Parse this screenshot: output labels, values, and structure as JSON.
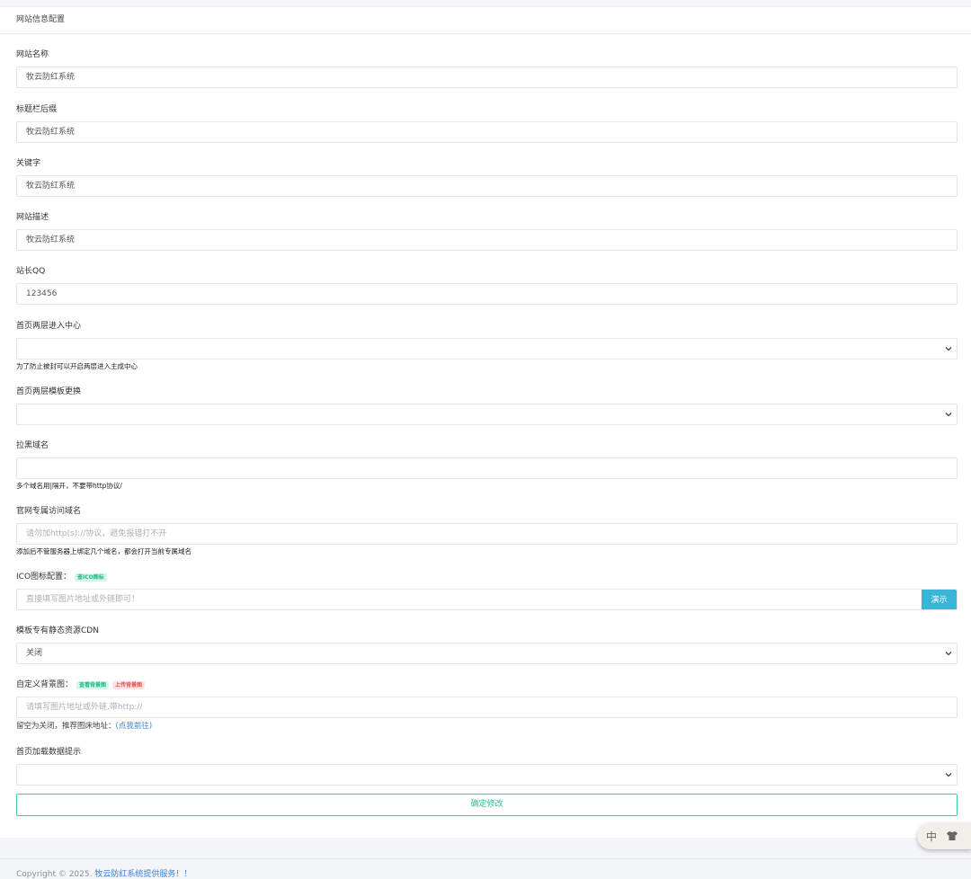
{
  "header": {
    "title": "网站信息配置"
  },
  "fields": {
    "site_name": {
      "label": "网站名称",
      "value": "牧云防红系统"
    },
    "title_suffix": {
      "label": "标题栏后缀",
      "value": "牧云防红系统"
    },
    "keywords": {
      "label": "关键字",
      "value": "牧云防红系统"
    },
    "description": {
      "label": "网站描述",
      "value": "牧云防红系统"
    },
    "qq": {
      "label": "站长QQ",
      "value": "123456"
    },
    "home_two_layer": {
      "label": "首页两层进入中心",
      "value": "",
      "help": "为了防止被封可以开启两层进入主成中心"
    },
    "home_template": {
      "label": "首页两层模板更换",
      "value": ""
    },
    "blacklist_domains": {
      "label": "拉黑域名",
      "value": "",
      "help": "多个域名用|隔开，不要带http协议/"
    },
    "official_domain": {
      "label": "官网专属访问域名",
      "placeholder": "请勿加http(s)://协议，避免报错打不开",
      "help": "添加后不管服务器上绑定几个域名，都会打开当前专属域名"
    },
    "ico": {
      "label": "ICO图标配置：",
      "badge": "查ICO图标",
      "placeholder": "直接填写图片地址或外链即可！",
      "button": "演示"
    },
    "cdn": {
      "label": "模板专有静态资源CDN",
      "value": "关闭"
    },
    "background": {
      "label": "自定义背景图：",
      "badge_view": "查看背景图",
      "badge_upload": "上传背景图",
      "placeholder": "请填写图片地址或外链,带http://",
      "help_prefix": "留空为关闭，推荐图床地址：",
      "help_link": "(点我前往)"
    },
    "load_tip": {
      "label": "首页加载数据提示",
      "value": ""
    }
  },
  "submit_label": "确定修改",
  "footer": {
    "prefix": "Copyright © 2025. ",
    "link": "牧云防红系统提供服务！！"
  },
  "lang_widget": {
    "lang": "中",
    "icon": "shirt-icon"
  }
}
